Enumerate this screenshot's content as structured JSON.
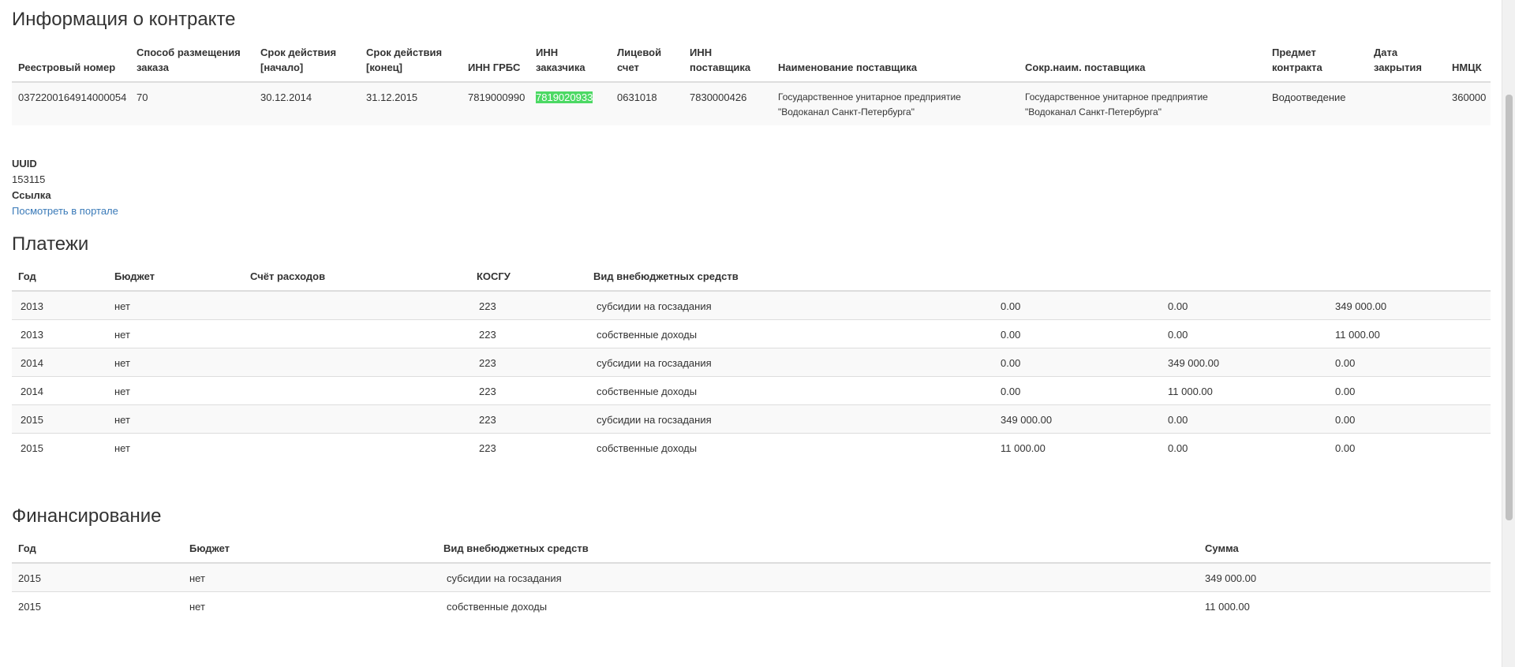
{
  "contract": {
    "title": "Информация о контракте",
    "headers": [
      "Реестровый номер",
      "Способ размещения заказа",
      "Срок действия [начало]",
      "Срок действия [конец]",
      "ИНН ГРБС",
      "ИНН заказчика",
      "Лицевой счет",
      "ИНН поставщика",
      "Наименование поставщика",
      "Сокр.наим. поставщика",
      "Предмет контракта",
      "Дата закрытия",
      "НМЦК"
    ],
    "row": {
      "reg_number": "0372200164914000054",
      "method": "70",
      "start": "30.12.2014",
      "end": "31.12.2015",
      "inn_grbs": "7819000990",
      "inn_customer": "7819020933",
      "account": "0631018",
      "inn_supplier": "7830000426",
      "supplier_name": "Государственное унитарное предприятие \"Водоканал Санкт-Петербурга\"",
      "supplier_short": "Государственное унитарное предприятие \"Водоканал Санкт-Петербурга\"",
      "subject": "Водоотведение",
      "close_date": "",
      "nmck": "360000"
    }
  },
  "meta": {
    "uuid_label": "UUID",
    "uuid_value": "153115",
    "link_label": "Ссылка",
    "link_text": "Посмотреть в портале"
  },
  "payments": {
    "title": "Платежи",
    "headers": [
      "Год",
      "Бюджет",
      "Счёт расходов",
      "КОСГУ",
      "Вид внебюджетных средств",
      "",
      "",
      ""
    ],
    "rows": [
      [
        "2013",
        "нет",
        "",
        "223",
        "субсидии на госзадания",
        "0.00",
        "0.00",
        "349 000.00"
      ],
      [
        "2013",
        "нет",
        "",
        "223",
        "собственные доходы",
        "0.00",
        "0.00",
        "11 000.00"
      ],
      [
        "2014",
        "нет",
        "",
        "223",
        "субсидии на госзадания",
        "0.00",
        "349 000.00",
        "0.00"
      ],
      [
        "2014",
        "нет",
        "",
        "223",
        "собственные доходы",
        "0.00",
        "11 000.00",
        "0.00"
      ],
      [
        "2015",
        "нет",
        "",
        "223",
        "субсидии на госзадания",
        "349 000.00",
        "0.00",
        "0.00"
      ],
      [
        "2015",
        "нет",
        "",
        "223",
        "собственные доходы",
        "11 000.00",
        "0.00",
        "0.00"
      ]
    ]
  },
  "financing": {
    "title": "Финансирование",
    "headers": [
      "Год",
      "Бюджет",
      "Вид внебюджетных средств",
      "Сумма"
    ],
    "rows": [
      [
        "2015",
        "нет",
        "субсидии на госзадания",
        "349 000.00"
      ],
      [
        "2015",
        "нет",
        "собственные доходы",
        "11 000.00"
      ]
    ]
  },
  "colors": {
    "highlight": "#4cd964",
    "link": "#3a7ab8"
  }
}
